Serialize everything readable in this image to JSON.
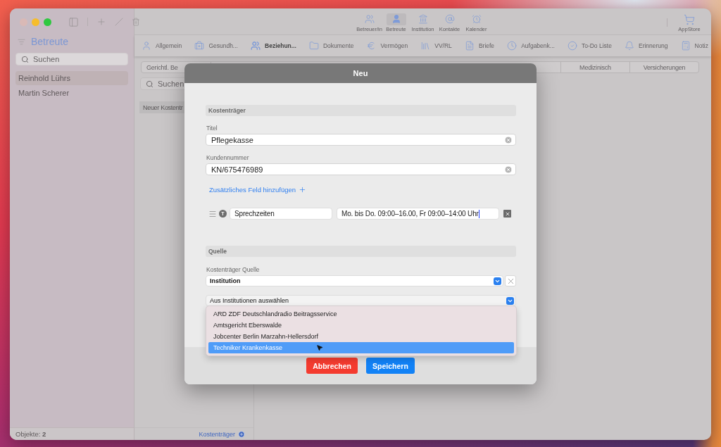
{
  "sidebar": {
    "title": "Betreute",
    "search": {
      "placeholder": "Suchen"
    },
    "items": [
      {
        "label": "Reinhold Lührs",
        "selected": true
      },
      {
        "label": "Martin Scherer",
        "selected": false
      }
    ],
    "footer": {
      "label": "Objekte:",
      "count": "2"
    }
  },
  "toolbar": {
    "items": [
      {
        "label": "Betreuer/in",
        "selected": false
      },
      {
        "label": "Betreute",
        "selected": true
      },
      {
        "label": "Institution",
        "selected": false
      },
      {
        "label": "Kontakte",
        "selected": false
      },
      {
        "label": "Kalender",
        "selected": false
      }
    ],
    "store": {
      "label": "AppStore"
    }
  },
  "tabs": [
    {
      "label": "Allgemein",
      "selected": false
    },
    {
      "label": "Gesundh...",
      "selected": false
    },
    {
      "label": "Beziehun...",
      "selected": true
    },
    {
      "label": "Dokumente",
      "selected": false
    },
    {
      "label": "Vermögen",
      "selected": false
    },
    {
      "label": "VV/RL",
      "selected": false
    },
    {
      "label": "Briefe",
      "selected": false
    },
    {
      "label": "Aufgabenk...",
      "selected": false
    },
    {
      "label": "To-Do Liste",
      "selected": false
    },
    {
      "label": "Erinnerung",
      "selected": false
    },
    {
      "label": "Notiz",
      "selected": false
    }
  ],
  "segments": [
    {
      "label": "Gerichtl. Be"
    },
    {
      "label": "Medizinisch"
    },
    {
      "label": "Versicherungen"
    }
  ],
  "list_pane": {
    "search": {
      "placeholder": "Suchen"
    },
    "items": [
      {
        "label": "Neuer Kostentr"
      }
    ],
    "footer_button": "Kostenträger"
  },
  "dialog": {
    "title": "Neu",
    "cost_section": {
      "heading": "Kostenträger",
      "fields": [
        {
          "label": "Titel",
          "value": "Pflegekasse"
        },
        {
          "label": "Kundennummer",
          "value": "KN/675476989"
        }
      ],
      "add_field_link": "Zusätzliches Feld hinzufügen",
      "custom_fields": [
        {
          "type_badge": "T",
          "name": "Sprechzeiten",
          "value": "Mo. bis Do. 09:00–16.00, Fr 09:00–14:00 Uhr",
          "focused": true
        }
      ]
    },
    "source_section": {
      "heading": "Quelle",
      "label": "Kostenträger Quelle",
      "source_select": {
        "value": "Institution"
      },
      "institution_select": {
        "value": "Aus Institutionen auswählen",
        "expanded": true,
        "options": [
          {
            "label": "ARD ZDF Deutschlandradio Beitragsservice",
            "selected": false
          },
          {
            "label": "Amtsgericht Eberswalde",
            "selected": false
          },
          {
            "label": "Jobcenter Berlin Marzahn-Hellersdorf",
            "selected": false
          },
          {
            "label": "Techniker Krankenkasse",
            "selected": true
          }
        ]
      }
    },
    "buttons": [
      {
        "label": "Abbrechen",
        "kind": "cancel"
      },
      {
        "label": "Speichern",
        "kind": "save"
      }
    ]
  }
}
